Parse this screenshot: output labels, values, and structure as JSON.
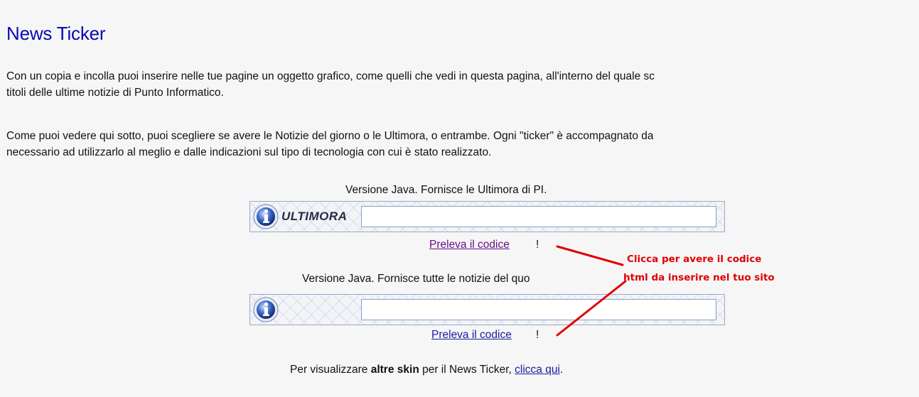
{
  "page": {
    "title": "News Ticker",
    "intro_line1": "Con un copia e incolla puoi inserire nelle tue pagine un oggetto grafico, come quelli che vedi in questa pagina, all'interno del quale sc",
    "intro_line2": "titoli delle ultime notizie di Punto Informatico.",
    "desc_line1": "Come puoi vedere qui sotto, puoi scegliere se avere le Notizie del giorno o le Ultimora, o entrambe. Ogni \"ticker\" è accompagnato da",
    "desc_line2": "necessario ad utilizzarlo al meglio e dalle indicazioni sul tipo di tecnologia con cui è stato realizzato."
  },
  "tickers": [
    {
      "caption": "Versione Java. Fornisce le Ultimora di PI.",
      "brand": "ULTIMORA",
      "link_label": "Preleva il codice",
      "suffix": "!"
    },
    {
      "caption": "Versione Java. Fornisce tutte le notizie del quo",
      "brand": "",
      "link_label": "Preleva il codice",
      "suffix": "!"
    }
  ],
  "annotation": {
    "line1": "Clicca per avere il codice",
    "line2": "html da inserire nel tuo sito"
  },
  "footer": {
    "prefix": "Per visualizzare ",
    "bold": "altre skin",
    "middle": " per il News Ticker, ",
    "link": "clicca qui",
    "suffix": "."
  },
  "colors": {
    "title": "#0a09b0",
    "link": "#1a1aa0",
    "visited_link": "#660f88",
    "annotation": "#e00000",
    "background": "#f6f6f6"
  },
  "icons": [
    "info-icon"
  ]
}
